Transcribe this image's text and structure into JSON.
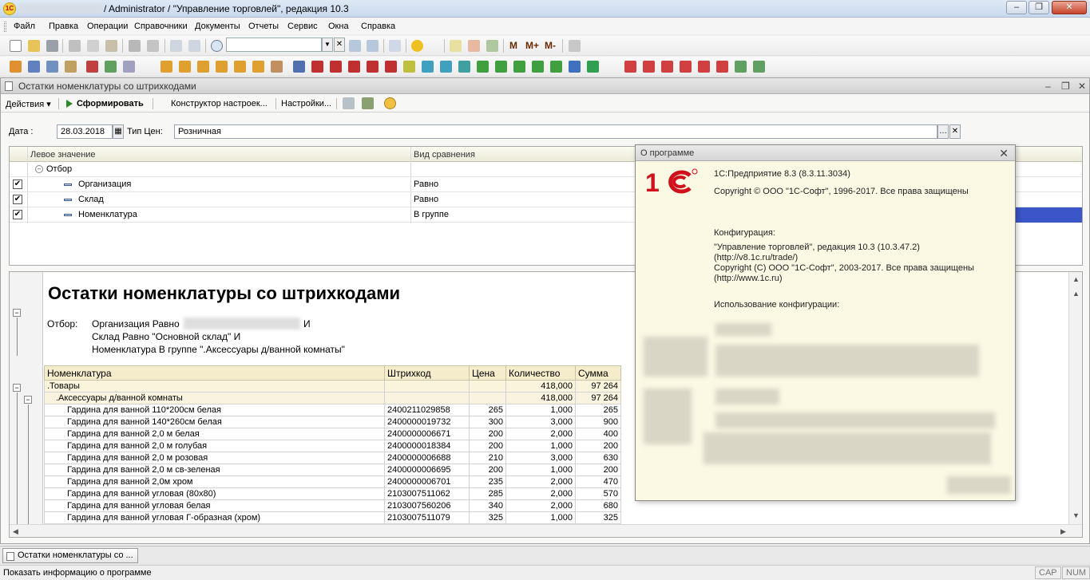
{
  "window": {
    "title": "/ Administrator / \"Управление торговлей\", редакция 10.3",
    "min": "‒",
    "max": "❐",
    "close": "✕"
  },
  "menu": [
    "Файл",
    "Правка",
    "Операции",
    "Справочники",
    "Документы",
    "Отчеты",
    "Сервис",
    "Окна",
    "Справка"
  ],
  "toolbar": {
    "m": "M",
    "mplus": "M+",
    "mminus": "M-"
  },
  "document": {
    "title": "Остатки номенклатуры со штрихкодами",
    "commands": {
      "actions": "Действия ▾",
      "generate": "Сформировать",
      "constructor": "Конструктор настроек...",
      "settings": "Настройки..."
    },
    "date_label": "Дата :",
    "date_value": "28.03.2018",
    "price_type_label": "Тип Цен:",
    "price_type_value": "Розничная",
    "filter_grid": {
      "col_left": "Левое значение",
      "col_compare": "Вид сравнения",
      "group": "Отбор",
      "rows": [
        {
          "left": "Организация",
          "compare": "Равно"
        },
        {
          "left": "Склад",
          "compare": "Равно"
        },
        {
          "left": "Номенклатура",
          "compare": "В группе"
        }
      ]
    },
    "report": {
      "title": "Остатки номенклатуры со штрихкодами",
      "filter_label": "Отбор:",
      "filter_lines": [
        "Организация Равно",
        "И",
        "Склад Равно \"Основной склад\" И",
        "Номенклатура В группе \".Аксессуары д/ванной комнаты\""
      ],
      "headers": [
        "Номенклатура",
        "Штрихкод",
        "Цена",
        "Количество",
        "Сумма"
      ],
      "group1": {
        "name": ".Товары",
        "qty": "418,000",
        "sum": "97 264"
      },
      "group2": {
        "name": ".Аксессуары д/ванной комнаты",
        "qty": "418,000",
        "sum": "97 264"
      },
      "rows": [
        {
          "name": "Гардина для ванной 110*200см белая",
          "code": "2400211029858",
          "price": "265",
          "qty": "1,000",
          "sum": "265"
        },
        {
          "name": "Гардина для ванной 140*260см белая",
          "code": "2400000019732",
          "price": "300",
          "qty": "3,000",
          "sum": "900"
        },
        {
          "name": "Гардина для ванной 2,0 м белая",
          "code": "2400000006671",
          "price": "200",
          "qty": "2,000",
          "sum": "400"
        },
        {
          "name": "Гардина для ванной 2,0 м голубая",
          "code": "2400000018384",
          "price": "200",
          "qty": "1,000",
          "sum": "200"
        },
        {
          "name": "Гардина для ванной 2,0 м розовая",
          "code": "2400000006688",
          "price": "210",
          "qty": "3,000",
          "sum": "630"
        },
        {
          "name": "Гардина для ванной 2,0 м св-зеленая",
          "code": "2400000006695",
          "price": "200",
          "qty": "1,000",
          "sum": "200"
        },
        {
          "name": "Гардина для ванной 2,0м хром",
          "code": "2400000006701",
          "price": "235",
          "qty": "2,000",
          "sum": "470"
        },
        {
          "name": "Гардина для ванной угловая (80x80)",
          "code": "2103007511062",
          "price": "285",
          "qty": "2,000",
          "sum": "570"
        },
        {
          "name": "Гардина для ванной угловая белая",
          "code": "2103007560206",
          "price": "340",
          "qty": "2,000",
          "sum": "680"
        },
        {
          "name": "Гардина для ванной угловая Г-образная (хром)",
          "code": "2103007511079",
          "price": "325",
          "qty": "1,000",
          "sum": "325"
        }
      ]
    }
  },
  "about": {
    "title": "О программе",
    "product": "1С:Предприятие 8.3 (8.3.11.3034)",
    "copyright": "Copyright © ООО \"1С-Софт\", 1996-2017. Все права защищены",
    "config_label": "Конфигурация:",
    "config_name": "\"Управление торговлей\", редакция 10.3 (10.3.47.2)",
    "config_url": "(http://v8.1c.ru/trade/)",
    "config_copyright": "Copyright (С) ООО \"1С-Софт\", 2003-2017. Все права защищены",
    "config_site": "(http://www.1c.ru)",
    "usage_label": "Использование конфигурации:"
  },
  "taskbar": {
    "tab": "Остатки номенклатуры со ..."
  },
  "status": {
    "text": "Показать информацию о программе",
    "cap": "CAP",
    "num": "NUM"
  }
}
